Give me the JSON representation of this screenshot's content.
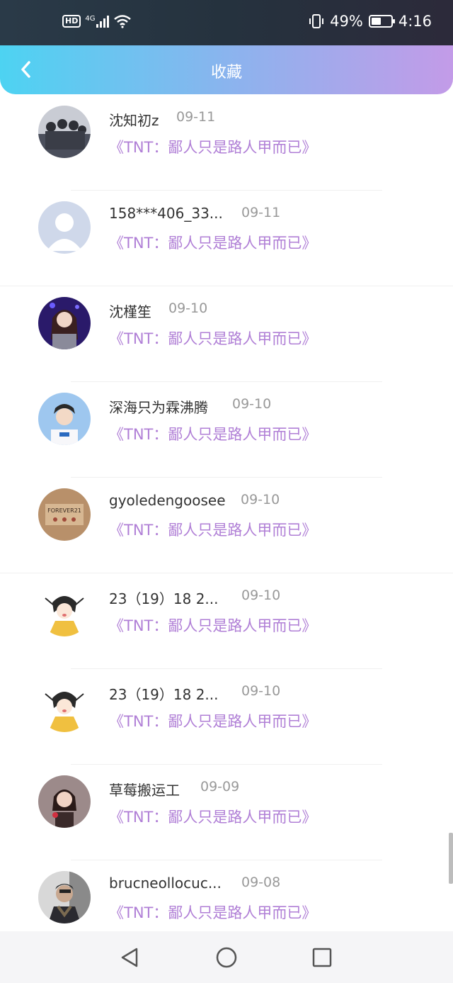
{
  "status_bar": {
    "hd": "HD",
    "network": "4G",
    "battery": "49%",
    "battery_level": 0.49,
    "time": "4:16"
  },
  "header": {
    "title": "收藏",
    "back_icon": "chevron-left-icon"
  },
  "items": [
    {
      "name": "沈知初z",
      "date": "09-11",
      "title": "《TNT：鄙人只是路人甲而已》",
      "avatar": "group-photo"
    },
    {
      "name": "158***406_33...",
      "date": "09-11",
      "title": "《TNT：鄙人只是路人甲而已》",
      "avatar": "default-user"
    },
    {
      "name": "沈槿笙",
      "date": "09-10",
      "title": "《TNT：鄙人只是路人甲而已》",
      "avatar": "girl-photo"
    },
    {
      "name": "深海只为霖沸腾",
      "date": "09-10",
      "title": "《TNT：鄙人只是路人甲而已》",
      "avatar": "boy-photo"
    },
    {
      "name": "gyoledengoosee",
      "date": "09-10",
      "title": "《TNT：鄙人只是路人甲而已》",
      "avatar": "forever21-photo"
    },
    {
      "name": "23（19）18 2...",
      "date": "09-10",
      "title": "《TNT：鄙人只是路人甲而已》",
      "avatar": "cartoon-character"
    },
    {
      "name": "23（19）18 2...",
      "date": "09-10",
      "title": "《TNT：鄙人只是路人甲而已》",
      "avatar": "cartoon-character"
    },
    {
      "name": "草莓搬运工",
      "date": "09-09",
      "title": "《TNT：鄙人只是路人甲而已》",
      "avatar": "child-photo"
    },
    {
      "name": "brucneollocuc...",
      "date": "09-08",
      "title": "《TNT：鄙人只是路人甲而已》",
      "avatar": "man-photo"
    }
  ],
  "colors": {
    "header_start": "#4dd3f2",
    "header_end": "#c39be8",
    "link": "#b07fd6",
    "name": "#333333",
    "date": "#999999"
  }
}
